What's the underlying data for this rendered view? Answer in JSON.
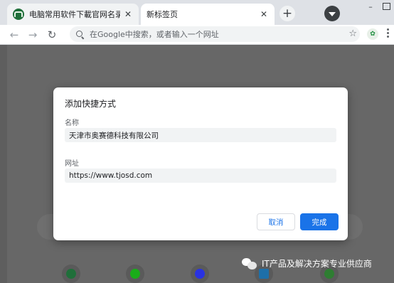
{
  "tabs": [
    {
      "title": "电脑常用软件下載官网名录|聊",
      "close": "✕"
    },
    {
      "title": "新标签页",
      "close": "✕"
    }
  ],
  "new_tab_symbol": "+",
  "omnibox": {
    "placeholder": "在Google中搜索，或者输入一个网址"
  },
  "dialog": {
    "title": "添加快捷方式",
    "name_label": "名称",
    "name_value": "天津市奥赛德科技有限公司",
    "url_label": "网址",
    "url_value": "https://www.tjosd.com",
    "cancel": "取消",
    "done": "完成"
  },
  "watermark": "IT产品及解决方案专业供应商",
  "icons": {
    "back": "←",
    "forward": "→",
    "reload": "↻",
    "star": "☆",
    "tab1_favicon": "phone-favicon-icon",
    "profile": "profile-icon",
    "extension": "extension-icon",
    "menu": "menu-icon"
  },
  "colors": {
    "accent": "#1a73e8",
    "overlay": "#676767"
  }
}
